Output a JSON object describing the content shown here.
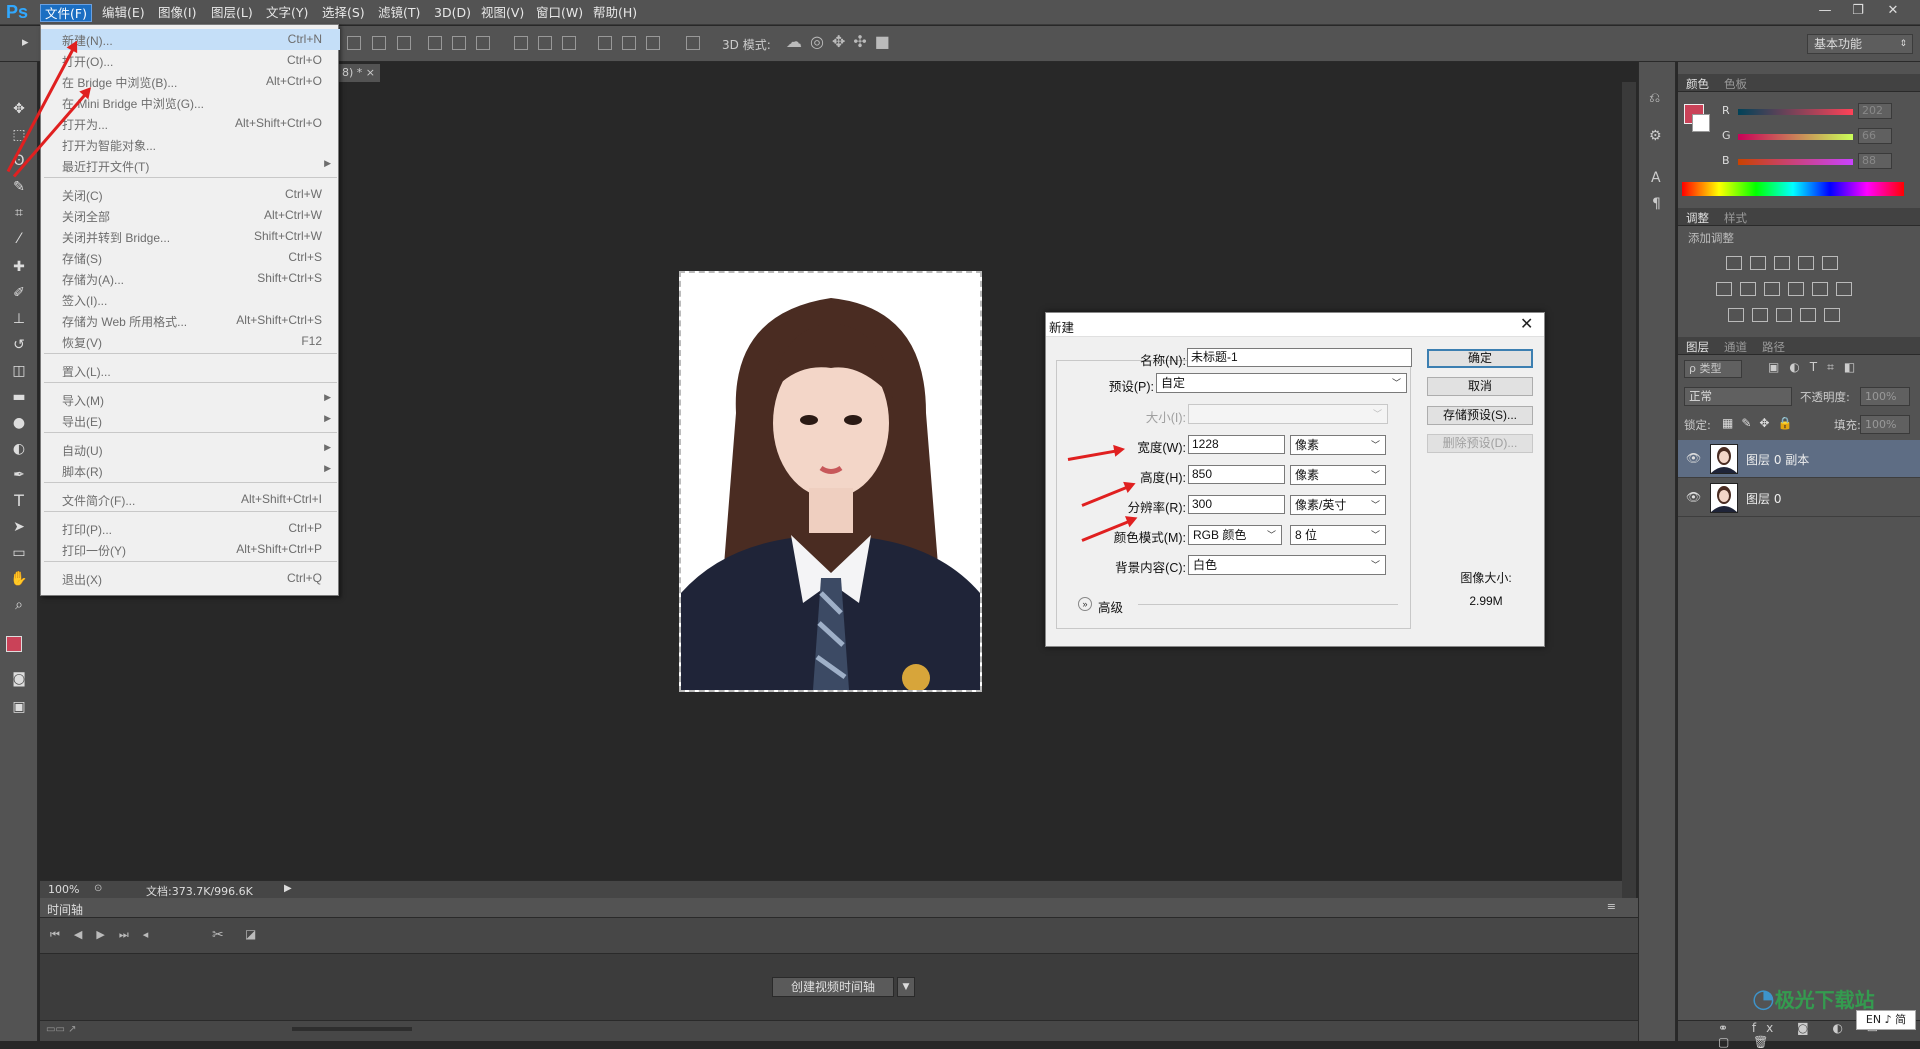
{
  "app": {
    "logo": "Ps"
  },
  "menubar": {
    "items": [
      "文件(F)",
      "编辑(E)",
      "图像(I)",
      "图层(L)",
      "文字(Y)",
      "选择(S)",
      "滤镜(T)",
      "3D(D)",
      "视图(V)",
      "窗口(W)",
      "帮助(H)"
    ],
    "active": "文件(F)"
  },
  "window_controls": {
    "minimize": "—",
    "restore": "❐",
    "close": "✕"
  },
  "options_bar": {
    "mode_3d_label": "3D 模式:",
    "workspace": "基本功能"
  },
  "doc_tab": {
    "label": "8) * ×"
  },
  "file_menu": {
    "groups": [
      [
        {
          "label": "新建(N)...",
          "shortcut": "Ctrl+N",
          "highlight": true
        },
        {
          "label": "打开(O)...",
          "shortcut": "Ctrl+O"
        },
        {
          "label": "在 Bridge 中浏览(B)...",
          "shortcut": "Alt+Ctrl+O"
        },
        {
          "label": "在 Mini Bridge 中浏览(G)...",
          "shortcut": ""
        },
        {
          "label": "打开为...",
          "shortcut": "Alt+Shift+Ctrl+O"
        },
        {
          "label": "打开为智能对象...",
          "shortcut": ""
        },
        {
          "label": "最近打开文件(T)",
          "shortcut": "",
          "submenu": true
        }
      ],
      [
        {
          "label": "关闭(C)",
          "shortcut": "Ctrl+W"
        },
        {
          "label": "关闭全部",
          "shortcut": "Alt+Ctrl+W"
        },
        {
          "label": "关闭并转到 Bridge...",
          "shortcut": "Shift+Ctrl+W"
        },
        {
          "label": "存储(S)",
          "shortcut": "Ctrl+S"
        },
        {
          "label": "存储为(A)...",
          "shortcut": "Shift+Ctrl+S"
        },
        {
          "label": "签入(I)...",
          "shortcut": ""
        },
        {
          "label": "存储为 Web 所用格式...",
          "shortcut": "Alt+Shift+Ctrl+S"
        },
        {
          "label": "恢复(V)",
          "shortcut": "F12"
        }
      ],
      [
        {
          "label": "置入(L)...",
          "shortcut": ""
        }
      ],
      [
        {
          "label": "导入(M)",
          "shortcut": "",
          "submenu": true
        },
        {
          "label": "导出(E)",
          "shortcut": "",
          "submenu": true
        }
      ],
      [
        {
          "label": "自动(U)",
          "shortcut": "",
          "submenu": true
        },
        {
          "label": "脚本(R)",
          "shortcut": "",
          "submenu": true
        }
      ],
      [
        {
          "label": "文件简介(F)...",
          "shortcut": "Alt+Shift+Ctrl+I"
        }
      ],
      [
        {
          "label": "打印(P)...",
          "shortcut": "Ctrl+P"
        },
        {
          "label": "打印一份(Y)",
          "shortcut": "Alt+Shift+Ctrl+P"
        }
      ],
      [
        {
          "label": "退出(X)",
          "shortcut": "Ctrl+Q"
        }
      ]
    ]
  },
  "dialog": {
    "title": "新建",
    "name_label": "名称(N):",
    "name_value": "未标题-1",
    "preset_label": "预设(P):",
    "preset_value": "自定",
    "size_label": "大小(I):",
    "size_value": "",
    "width_label": "宽度(W):",
    "width_value": "1228",
    "width_unit": "像素",
    "height_label": "高度(H):",
    "height_value": "850",
    "height_unit": "像素",
    "resolution_label": "分辨率(R):",
    "resolution_value": "300",
    "resolution_unit": "像素/英寸",
    "color_mode_label": "颜色模式(M):",
    "color_mode_value": "RGB 颜色",
    "bit_depth": "8 位",
    "bg_label": "背景内容(C):",
    "bg_value": "白色",
    "advanced_label": "高级",
    "ok": "确定",
    "cancel": "取消",
    "save_preset": "存储预设(S)...",
    "delete_preset": "删除预设(D)...",
    "image_size_label": "图像大小:",
    "image_size_value": "2.99M"
  },
  "status": {
    "zoom": "100%",
    "doc": "文档:373.7K/996.6K"
  },
  "timeline": {
    "title": "时间轴",
    "create_button": "创建视频时间轴"
  },
  "panels": {
    "color": {
      "tabs": [
        "颜色",
        "色板"
      ],
      "r_label": "R",
      "g_label": "G",
      "b_label": "B",
      "r": "202",
      "g": "66",
      "b": "88",
      "fg_color": "#ca4258"
    },
    "adjust": {
      "tabs": [
        "调整",
        "样式"
      ],
      "add_label": "添加调整"
    },
    "layers": {
      "tabs": [
        "图层",
        "通道",
        "路径"
      ],
      "kind_label": "ρ 类型",
      "blend_mode": "正常",
      "opacity_label": "不透明度:",
      "opacity_value": "100%",
      "lock_label": "锁定:",
      "fill_label": "填充:",
      "fill_value": "100%",
      "items": [
        {
          "name": "图层 0 副本",
          "selected": true
        },
        {
          "name": "图层 0",
          "selected": false
        }
      ]
    }
  },
  "watermark": {
    "text": "极光下载站",
    "ime": "EN ♪ 简"
  }
}
